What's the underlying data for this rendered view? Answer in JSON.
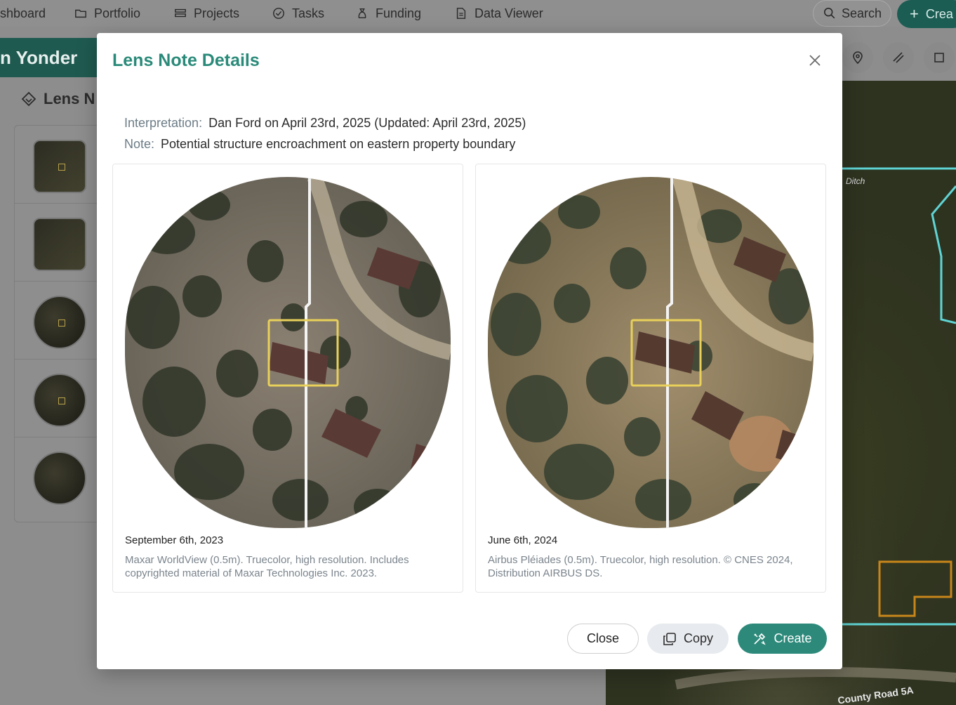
{
  "nav": {
    "items": [
      {
        "label": "shboard",
        "icon": "dashboard-icon"
      },
      {
        "label": "Portfolio",
        "icon": "folder-icon"
      },
      {
        "label": "Projects",
        "icon": "projects-icon"
      },
      {
        "label": "Tasks",
        "icon": "check-circle-icon"
      },
      {
        "label": "Funding",
        "icon": "money-bag-icon"
      },
      {
        "label": "Data Viewer",
        "icon": "document-icon"
      }
    ],
    "search_label": "Search",
    "create_label": "Crea"
  },
  "background": {
    "brand": "n Yonder",
    "left_title": "Lens N",
    "map_labels": {
      "ditch": "Ditch",
      "road": "County Road 5A"
    }
  },
  "modal": {
    "title": "Lens Note Details",
    "interpretation_label": "Interpretation:",
    "interpretation_value": "Dan Ford on April 23rd, 2025 (Updated: April 23rd, 2025)",
    "note_label": "Note:",
    "note_value": "Potential structure encroachment on eastern property boundary",
    "cards": [
      {
        "date": "September 6th, 2023",
        "credit": "Maxar WorldView (0.5m). Truecolor, high resolution. Includes copyrighted material of Maxar Technologies Inc. 2023."
      },
      {
        "date": "June 6th, 2024",
        "credit": "Airbus Pléiades (0.5m). Truecolor, high resolution. © CNES 2024, Distribution AIRBUS DS."
      }
    ],
    "buttons": {
      "close": "Close",
      "copy": "Copy",
      "create": "Create"
    }
  },
  "colors": {
    "accent": "#2a8a79",
    "highlight_box": "#e8d05a",
    "boundary_line": "#5fd4d4",
    "parcel_outline": "#c8861a"
  }
}
